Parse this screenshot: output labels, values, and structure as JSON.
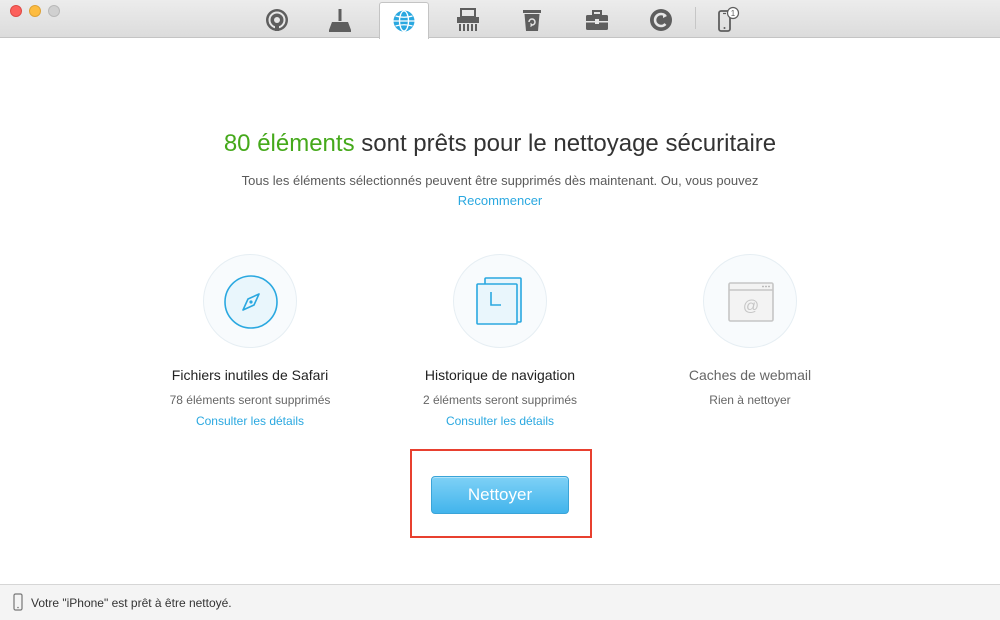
{
  "toolbar": {
    "items": [
      {
        "icon": "airbackup-icon"
      },
      {
        "icon": "broom-icon"
      },
      {
        "icon": "globe-icon",
        "active": true
      },
      {
        "icon": "shredder-icon"
      },
      {
        "icon": "trash-icon"
      },
      {
        "icon": "toolbox-icon"
      },
      {
        "icon": "refresh-icon"
      },
      {
        "icon": "iphone-icon",
        "badge": "1"
      }
    ]
  },
  "main": {
    "headline_count": "80 éléments",
    "headline_rest": " sont prêts pour le nettoyage sécuritaire",
    "subline": "Tous les éléments sélectionnés peuvent être supprimés dès maintenant. Ou, vous pouvez",
    "restart_link": "Recommencer",
    "categories": [
      {
        "icon": "compass-icon",
        "title": "Fichiers inutiles de Safari",
        "sub": "78 éléments seront supprimés",
        "link": "Consulter les détails"
      },
      {
        "icon": "history-icon",
        "title": "Historique de navigation",
        "sub": "2 éléments seront supprimés",
        "link": "Consulter les détails"
      },
      {
        "icon": "webmail-icon",
        "title": "Caches de webmail",
        "sub": "Rien à nettoyer"
      }
    ],
    "clean_button": "Nettoyer"
  },
  "status": {
    "text": "Votre \"iPhone\" est prêt à être nettoyé."
  },
  "colors": {
    "accent": "#2aa8e0",
    "count_green": "#45a91b",
    "highlight_red": "#e8402f"
  }
}
